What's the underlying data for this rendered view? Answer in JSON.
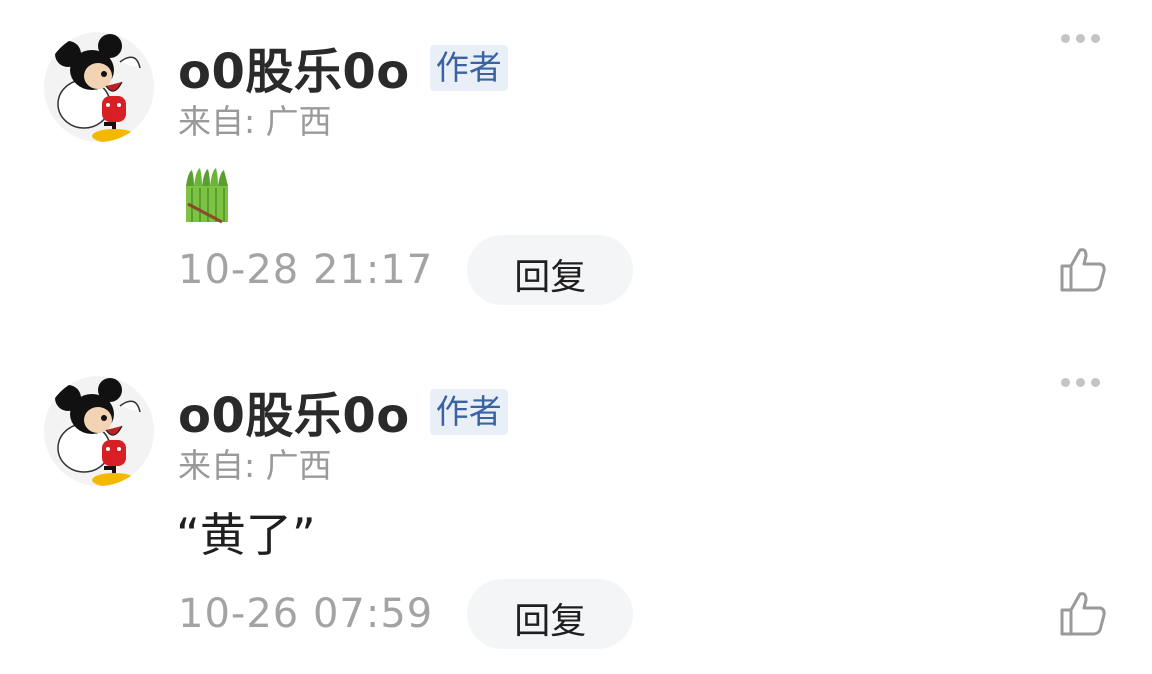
{
  "comments": [
    {
      "username": "o0股乐0o",
      "badge": "作者",
      "location": "来自: 广西",
      "content_type": "emoji",
      "content_emoji": "asparagus-emoji",
      "content_text": "",
      "timestamp": "10-28 21:17",
      "reply_label": "回复"
    },
    {
      "username": "o0股乐0o",
      "badge": "作者",
      "location": "来自: 广西",
      "content_type": "text",
      "content_text": "“黄了”",
      "timestamp": "10-26 07:59",
      "reply_label": "回复"
    }
  ],
  "icons": {
    "more": "more-dots-icon",
    "like": "thumbs-up-icon",
    "avatar": "mickey-mouse-avatar"
  },
  "colors": {
    "badge_bg": "#e9eff7",
    "badge_text": "#3a63a3",
    "muted_text": "#9a9a9a",
    "reply_bg": "#f4f5f7"
  }
}
